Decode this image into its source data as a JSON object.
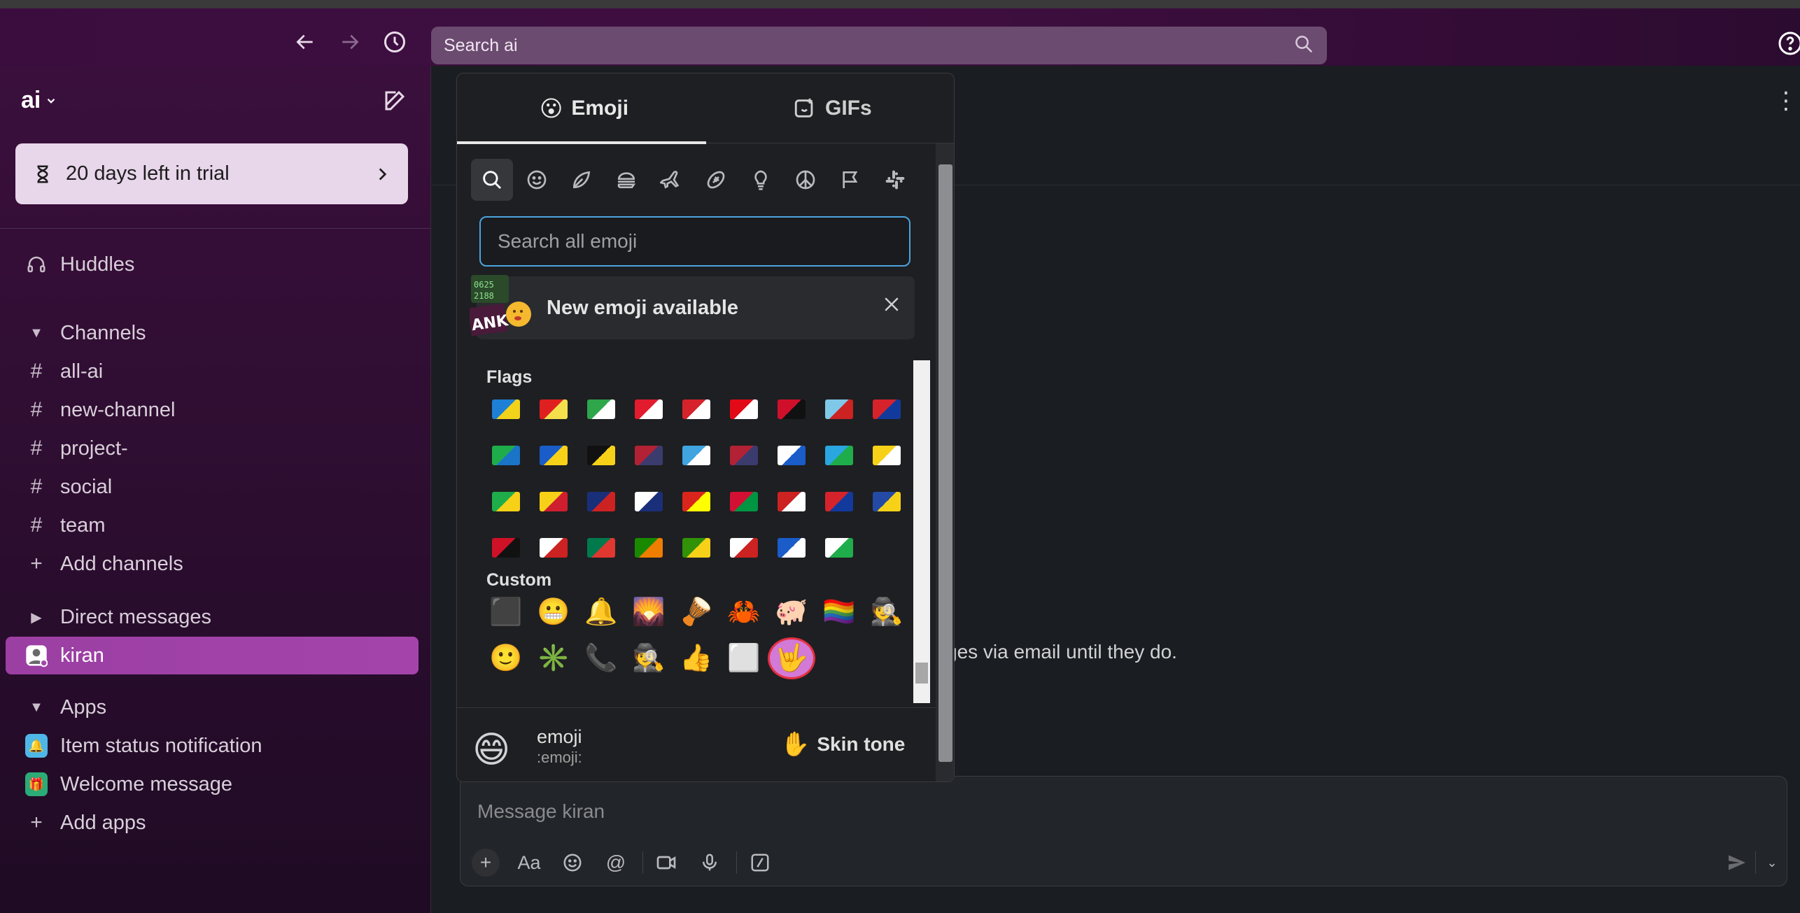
{
  "topbar": {
    "search_placeholder": "Search ai",
    "back": "back-arrow",
    "forward": "forward-arrow",
    "history": "history-clock",
    "help": "help-circle"
  },
  "sidebar": {
    "workspace_name": "ai",
    "trial_label": "20 days left in trial",
    "huddles": "Huddles",
    "channels_header": "Channels",
    "channels": [
      "all-ai",
      "new-channel",
      "project-",
      "social",
      "team"
    ],
    "add_channels": "Add channels",
    "dm_header": "Direct messages",
    "dm_user": "kiran",
    "apps_header": "Apps",
    "apps": [
      {
        "label": "Item status notification",
        "color": "#4fb7e8"
      },
      {
        "label": "Welcome message",
        "color": "#2bac76"
      }
    ],
    "add_apps": "Add apps"
  },
  "main": {
    "email_note": "ges via email until they do.",
    "composer_placeholder": "Message kiran"
  },
  "picker": {
    "tab_emoji": "Emoji",
    "tab_gifs": "GIFs",
    "search_placeholder": "Search all emoji",
    "new_emoji_label": "New emoji available",
    "flags_title": "Flags",
    "custom_title": "Custom",
    "preview_name": "emoji",
    "preview_code": ":emoji:",
    "skin_tone_label": "Skin tone",
    "categories": [
      "search",
      "smileys",
      "nature",
      "food",
      "travel",
      "activities",
      "objects",
      "symbols",
      "flags",
      "slack"
    ],
    "flag_rows": [
      [
        [
          "#1e7fd6",
          "#f3d21b"
        ],
        [
          "#e02020",
          "#f4e04d"
        ],
        [
          "#2ea64a",
          "#ffffff"
        ],
        [
          "#e21c2e",
          "#ffffff"
        ],
        [
          "#d6232b",
          "#ffffff"
        ],
        [
          "#e30a17",
          "#ffffff"
        ],
        [
          "#d0102b",
          "#111111"
        ],
        [
          "#7fc8e8",
          "#cc2222"
        ],
        [
          "#d6232b",
          "#123a9c"
        ]
      ],
      [
        [
          "#1ead4a",
          "#1a74c8"
        ],
        [
          "#1a5cc8",
          "#f7d118"
        ],
        [
          "#111111",
          "#f7d118"
        ],
        [
          "#b22234",
          "#3c3b6e"
        ],
        [
          "#3fa4df",
          "#ffffff"
        ],
        [
          "#b22234",
          "#3c3b6e"
        ],
        [
          "#ffffff",
          "#1a5cc8"
        ],
        [
          "#2aa6e0",
          "#1ead4a"
        ],
        [
          "#f7d118",
          "#ffffff"
        ]
      ],
      [
        [
          "#1ead4a",
          "#f7d118"
        ],
        [
          "#f7d118",
          "#cf1f2f"
        ],
        [
          "#1a2f7a",
          "#cc2222"
        ],
        [
          "#ffffff",
          "#1a2f7a"
        ],
        [
          "#da251d",
          "#ffff00"
        ],
        [
          "#d21034",
          "#009543"
        ],
        [
          "#cc2222",
          "#ffffff"
        ],
        [
          "#d6232b",
          "#123a9c"
        ],
        [
          "#244aa5",
          "#f7d118"
        ]
      ],
      [
        [
          "#ce1126",
          "#111111"
        ],
        [
          "#ffffff",
          "#cc2222"
        ],
        [
          "#007a4d",
          "#de3831"
        ],
        [
          "#198a00",
          "#ef7d00"
        ],
        [
          "#319208",
          "#f7d118"
        ],
        [
          "#ffffff",
          "#cc2222"
        ],
        [
          "#1a5cc8",
          "#ffffff"
        ],
        [
          "#ffffff",
          "#1ead4a"
        ]
      ]
    ],
    "custom_rows": [
      [
        "⬛",
        "😬",
        "🔔",
        "🌄",
        "🪘",
        "🦀",
        "🐖",
        "🏳️‍🌈",
        "🕵️"
      ],
      [
        "🙂",
        "✳️",
        "📞",
        "🕵️",
        "👍",
        "⬜",
        "🤟"
      ]
    ]
  }
}
